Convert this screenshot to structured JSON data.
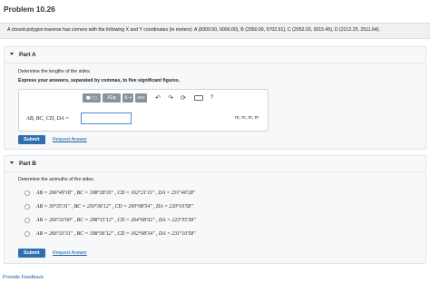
{
  "problem": {
    "title": "Problem 10.26",
    "statement": "A closed-polygon traverse has corners with the following X and Y coordinates (in meters): A (8300.00, 6000.00), B (2950.00, 5702.91), C (2052.03, 3015.45), D (2212.25, 2511.64)."
  },
  "part_a": {
    "header": "Part A",
    "question": "Determine the lengths of the sides.",
    "instruction": "Express your answers, separated by commas, to five significant figures.",
    "toolbar": {
      "templates_label": "■√□",
      "greek_label": "AΣφ",
      "arrows_label": "⇅→",
      "vec_label": "vec",
      "undo_icon": "undo-icon",
      "redo_icon": "redo-icon",
      "reset_icon": "reset-icon",
      "keyboard_icon": "keyboard-icon",
      "help_label": "?"
    },
    "equation_label": "AB, BC, CD, DA =",
    "answer_value": "",
    "units": "m, m, m, m",
    "submit_label": "Submit",
    "request_label": "Request Answer"
  },
  "part_b": {
    "header": "Part B",
    "question": "Determine the azimuths of the sides.",
    "choices": [
      "AB = 266°49′18″ , BC = 198°28′35″ , CD = 162°21′11″ , DA = 231°40′28″",
      "AB = 30°35′31″ , BC = 250°36′12″ , CD = 200°08′54″ , DA = 220°10′58″",
      "AB = 266°33′00″ , BC = 298°15′12″ , CD = 264°08′02″ , DA = 223°55′58″",
      "AB = 266°33′31″ , BC = 198°36′12″ , CD = 162°08′54″ , DA = 231°10′58″"
    ],
    "submit_label": "Submit",
    "request_label": "Request Answer"
  },
  "footer": {
    "feedback_label": "Provide Feedback"
  }
}
